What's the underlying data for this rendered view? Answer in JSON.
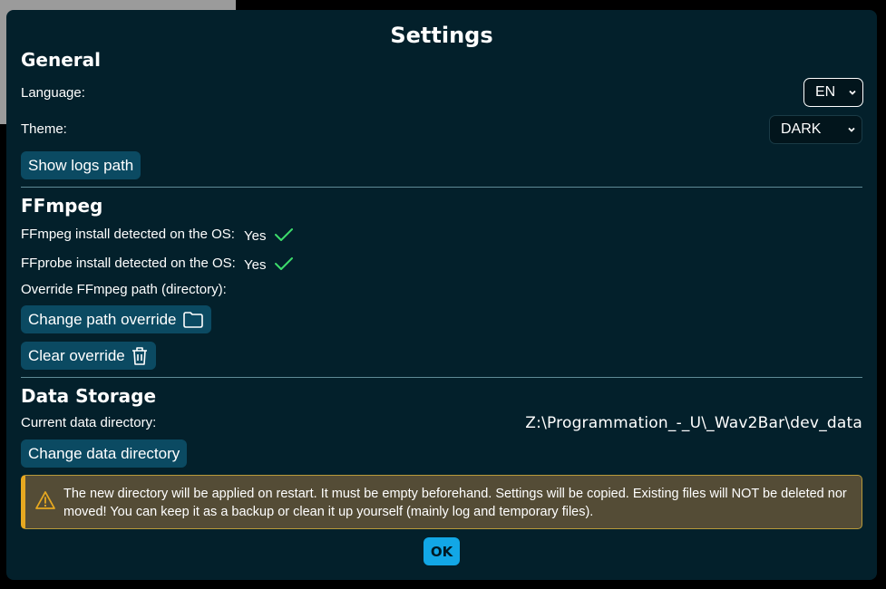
{
  "dialog": {
    "title": "Settings",
    "ok_label": "OK"
  },
  "general": {
    "title": "General",
    "language_label": "Language:",
    "language_value": "EN",
    "theme_label": "Theme:",
    "theme_value": "DARK",
    "show_logs_label": "Show logs path"
  },
  "ffmpeg": {
    "title": "FFmpeg",
    "ffmpeg_detect_label": "FFmpeg install detected on the OS:",
    "ffmpeg_detect_value": "Yes",
    "ffprobe_detect_label": "FFprobe install detected on the OS:",
    "ffprobe_detect_value": "Yes",
    "override_label": "Override FFmpeg path (directory):",
    "change_override_label": "Change path override",
    "clear_override_label": "Clear override"
  },
  "storage": {
    "title": "Data Storage",
    "current_dir_label": "Current data directory:",
    "current_dir_value": "Z:\\Programmation_-_U\\_Wav2Bar\\dev_data",
    "change_dir_label": "Change data directory",
    "warning_text": "The new directory will be applied on restart. It must be empty beforehand. Settings will be copied. Existing files will NOT be deleted nor moved! You can keep it as a backup or clean it up yourself (mainly log and temporary files)."
  },
  "colors": {
    "modal_bg": "#03202b",
    "button_bg": "#0b4a62",
    "accent": "#12a7e6",
    "success": "#3ddc6b",
    "warning": "#e6a820"
  },
  "icons": {
    "check": "check-icon",
    "folder": "folder-icon",
    "trash": "trash-icon",
    "warning": "warning-triangle-icon",
    "chevron": "chevron-down-icon"
  }
}
